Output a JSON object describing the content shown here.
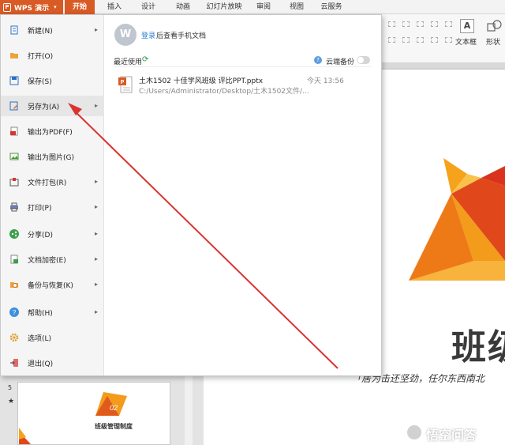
{
  "titlebar": {
    "app_button": "WPS 演示",
    "tabs": [
      "开始",
      "插入",
      "设计",
      "动画",
      "幻灯片放映",
      "审阅",
      "视图",
      "云服务"
    ],
    "active_tab": "开始"
  },
  "ribbon": {
    "textbox_label": "文本框",
    "shape_label": "形状",
    "textbox_icon_glyph": "A"
  },
  "file_menu": {
    "items": [
      {
        "label": "新建(N)",
        "icon": "new-file-icon",
        "submenu": true
      },
      {
        "label": "打开(O)",
        "icon": "open-folder-icon",
        "submenu": false
      },
      {
        "label": "保存(S)",
        "icon": "save-icon",
        "submenu": false
      },
      {
        "label": "另存为(A)",
        "icon": "save-as-icon",
        "submenu": true
      },
      {
        "label": "输出为PDF(F)",
        "icon": "pdf-icon",
        "submenu": false
      },
      {
        "label": "输出为图片(G)",
        "icon": "image-export-icon",
        "submenu": false
      },
      {
        "label": "文件打包(R)",
        "icon": "package-icon",
        "submenu": true
      },
      {
        "label": "打印(P)",
        "icon": "print-icon",
        "submenu": true
      },
      {
        "label": "分享(D)",
        "icon": "share-icon",
        "submenu": true
      },
      {
        "label": "文档加密(E)",
        "icon": "encrypt-icon",
        "submenu": true
      },
      {
        "label": "备份与恢复(K)",
        "icon": "backup-icon",
        "submenu": true
      },
      {
        "label": "帮助(H)",
        "icon": "help-icon",
        "submenu": true
      },
      {
        "label": "选项(L)",
        "icon": "gear-icon",
        "submenu": false
      },
      {
        "label": "退出(Q)",
        "icon": "exit-icon",
        "submenu": false
      }
    ],
    "login": {
      "avatar_letter": "W",
      "link": "登录",
      "text": "后查看手机文档"
    },
    "recent_label": "最近使用",
    "cloud_backup_label": "云端备份",
    "cloud_help_glyph": "?",
    "cloud_backup_enabled": false,
    "recent_files": [
      {
        "name": "土木1502 十佳学风班级 评比PPT.pptx",
        "path": "C:/Users/Administrator/Desktop/土木1502文件/...",
        "time": "今天 13:56"
      }
    ]
  },
  "slide": {
    "title": "班级",
    "subtitle": "「居为击还坚劲，任尔东西南北"
  },
  "thumbnail": {
    "number": "5",
    "star": "★",
    "badge_text": "02",
    "title": "班级管理制度"
  },
  "watermark": {
    "text": "悟空问答"
  },
  "colors": {
    "accent": "#d85a25",
    "arrow": "#d9332f",
    "slide_orange": "#f39b1a",
    "slide_red": "#e05a1c"
  }
}
